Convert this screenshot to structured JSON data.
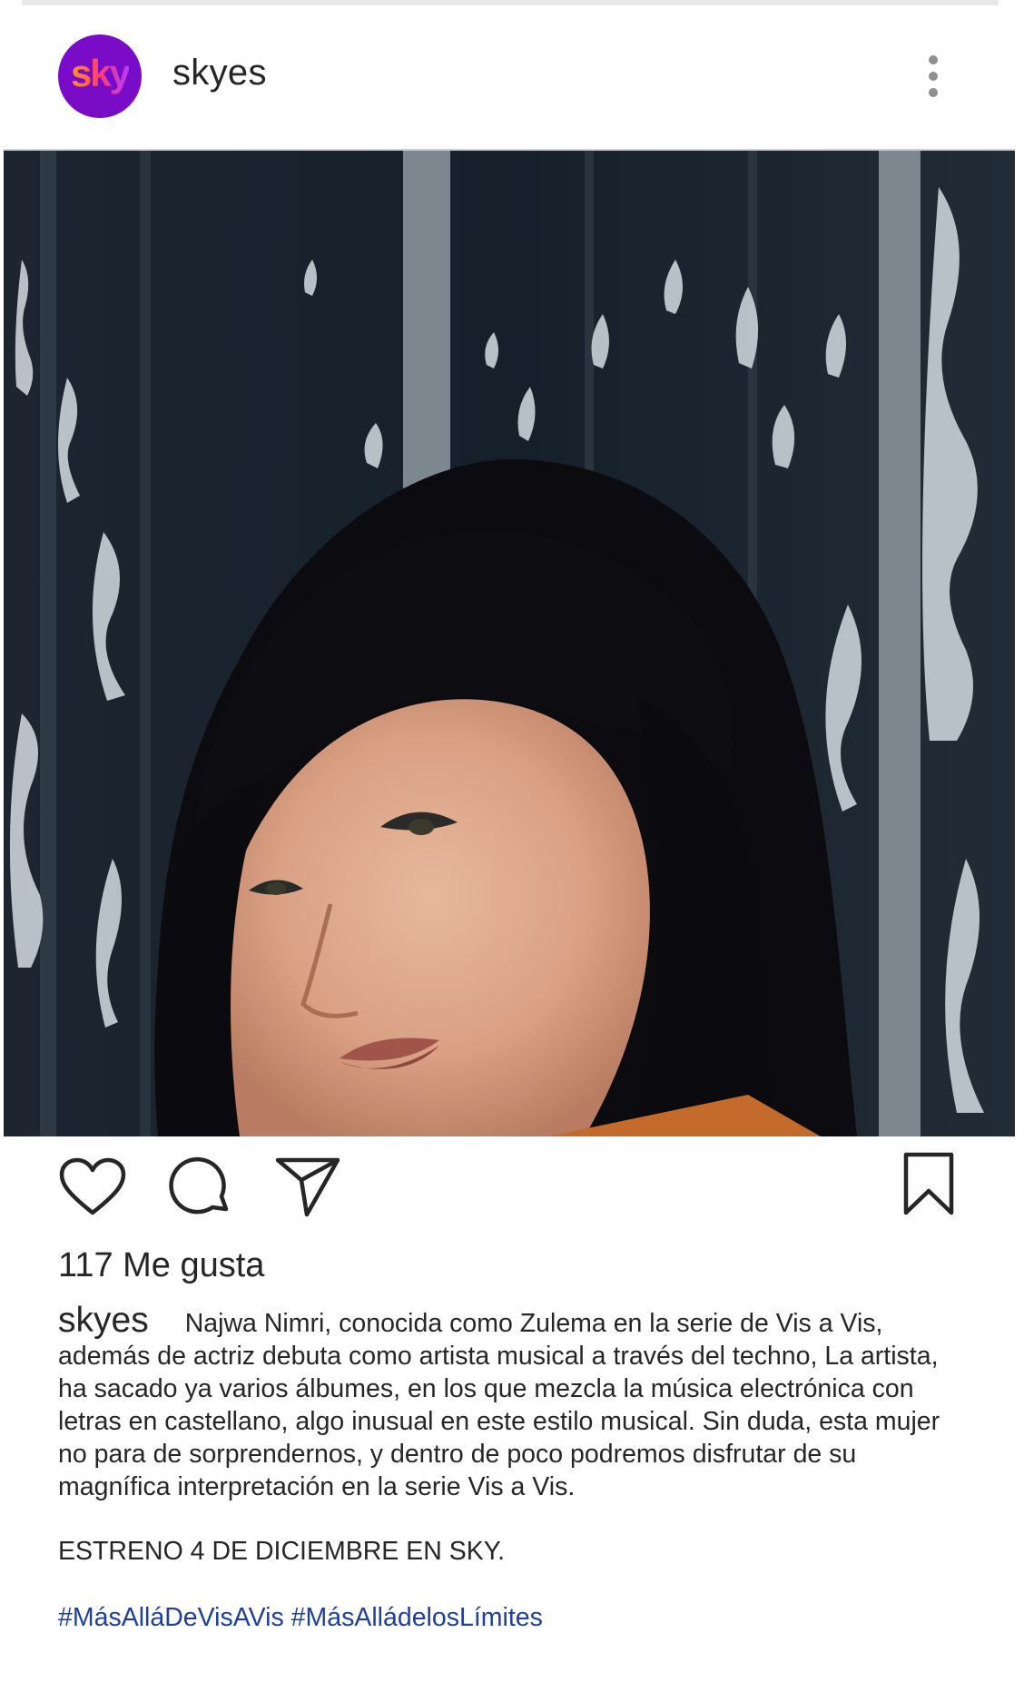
{
  "post": {
    "username": "skyes",
    "avatar_logo": "sky",
    "avatar_color": "#7a0cc7",
    "more_icon": "more-vertical-icon",
    "photo_icon": "portrait-photo",
    "actions": {
      "like_icon": "heart-icon",
      "comment_icon": "comment-icon",
      "share_icon": "send-icon",
      "save_icon": "bookmark-icon"
    },
    "likes": "117 Me gusta",
    "caption": {
      "username": "skyes",
      "text": "Najwa Nimri, conocida como Zulema en la serie de Vis a Vis, además de actriz debuta como artista musical a través del techno, La artista, ha sacado ya varios álbumes, en los que mezcla la música electrónica con letras en castellano, algo inusual en este estilo musical. Sin duda, esta mujer no para de sorprendernos, y dentro de poco podremos disfrutar de su magnífica interpretación en la serie Vis a Vis."
    },
    "release": "ESTRENO 4 DE DICIEMBRE EN SKY.",
    "hashtags": [
      "#MásAlláDeVisAVis",
      "#MásAlládelosLímites"
    ],
    "hashtag_color": "#1f3fa0"
  }
}
